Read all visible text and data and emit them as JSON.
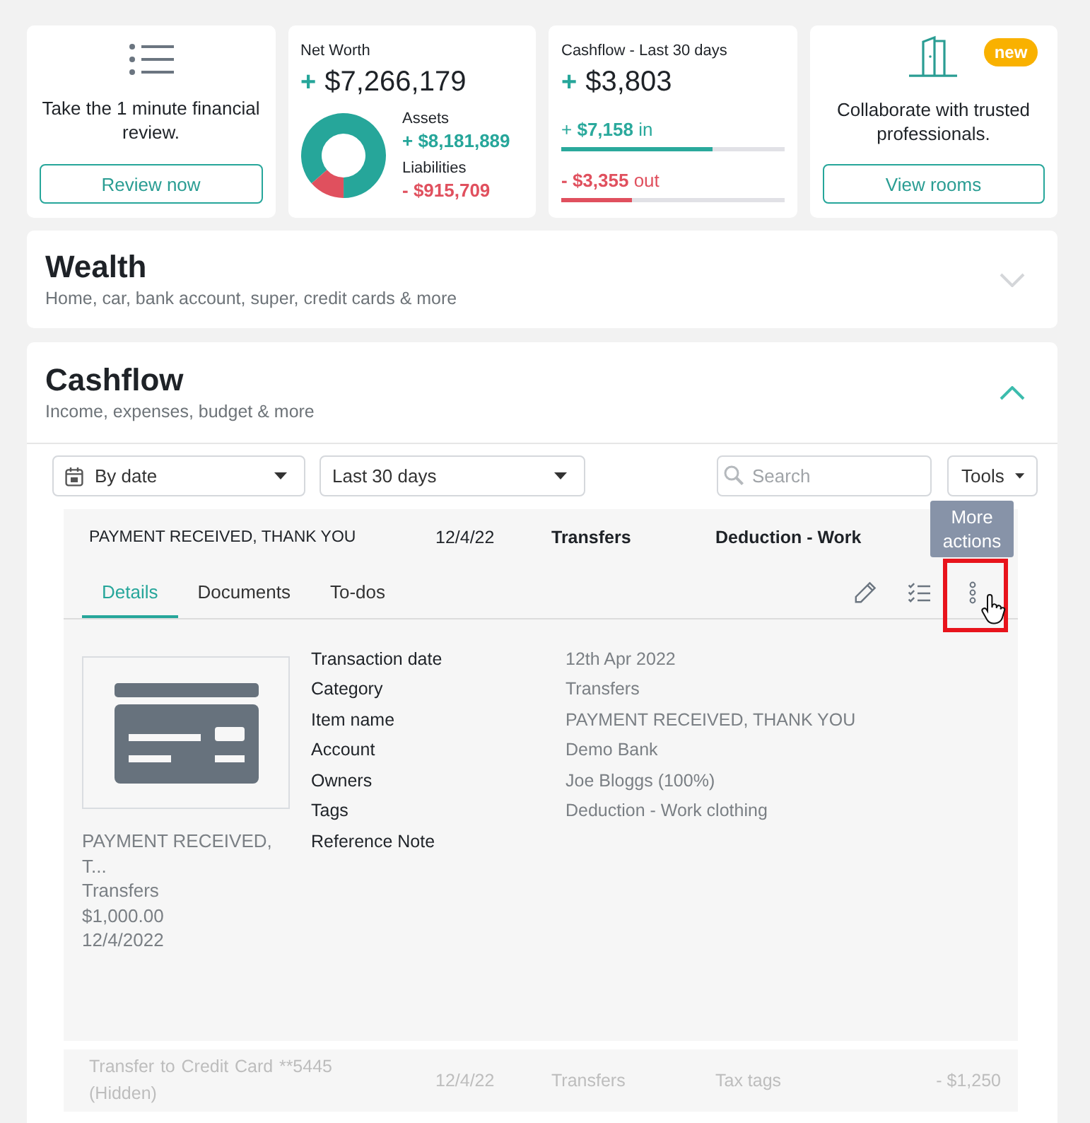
{
  "review_card": {
    "text": "Take the 1 minute financial review.",
    "button": "Review now"
  },
  "net_worth_card": {
    "title": "Net Worth",
    "sign": "+",
    "value": "$7,266,179",
    "breakdown": [
      {
        "kind": "assets",
        "label": "Assets",
        "value": "+ $8,181,889",
        "color": "#26a69a"
      },
      {
        "kind": "liabilities",
        "label": "Liabilities",
        "value": "- $915,709",
        "color": "#e0505e"
      }
    ]
  },
  "cashflow_card": {
    "title": "Cashflow - Last 30 days",
    "sign": "+",
    "value": "$3,803",
    "flows": [
      {
        "text": "+ **$7,158** in",
        "level": 0.68,
        "color": "#2aa99c"
      },
      {
        "text": "**- $3,355** out",
        "level": 0.32,
        "color": "#e0505e"
      }
    ]
  },
  "rooms_card": {
    "badge": "new",
    "text": "Collaborate with trusted professionals.",
    "button": "View rooms"
  },
  "wealth": {
    "title": "Wealth",
    "subtitle": "Home, car, bank account, super, credit cards & more",
    "expanded": false
  },
  "cashflow": {
    "title": "Cashflow",
    "subtitle": "Income, expenses, budget & more",
    "expanded": true,
    "toolbar": {
      "sort": "By date",
      "period": "Last 30 days",
      "search": {
        "placeholder": "Search"
      },
      "tools": "Tools"
    },
    "transactions": [
      {
        "name": "PAYMENT RECEIVED, THANK YOU",
        "date": "12/4/22",
        "category": "Transfers",
        "tags": "Deduction - Work",
        "expanded": true,
        "hidden": false,
        "tabs": [
          {
            "label": "Details",
            "selected": true
          },
          {
            "label": "Documents",
            "selected": false
          },
          {
            "label": "To-dos",
            "selected": false
          }
        ],
        "actions": [
          {
            "kind": "edit"
          },
          {
            "kind": "checklist"
          },
          {
            "kind": "more",
            "tooltip": "More actions"
          }
        ],
        "hover": {
          "kind": "more",
          "highlighted": true
        },
        "details": {
          "caption": [
            "PAYMENT RECEIVED, T...",
            "Transfers",
            "$1,000.00",
            "12/4/2022"
          ],
          "fields": [
            {
              "label": "Transaction date",
              "value": "12th Apr 2022"
            },
            {
              "label": "Category",
              "value": "Transfers"
            },
            {
              "label": "Item name",
              "value": "PAYMENT RECEIVED, THANK YOU"
            },
            {
              "label": "Account",
              "value": "Demo Bank"
            },
            {
              "label": "Owners",
              "value": "Joe Bloggs (100%)"
            },
            {
              "label": "Tags",
              "value": "Deduction - Work clothing"
            },
            {
              "label": "Reference Note"
            }
          ]
        }
      },
      {
        "name": "Transfer to Credit Card **5445 (Hidden)",
        "date": "12/4/22",
        "category": "Transfers",
        "tags": "Tax tags",
        "amount": "- $1,250",
        "expanded": false,
        "hidden": true
      }
    ]
  }
}
